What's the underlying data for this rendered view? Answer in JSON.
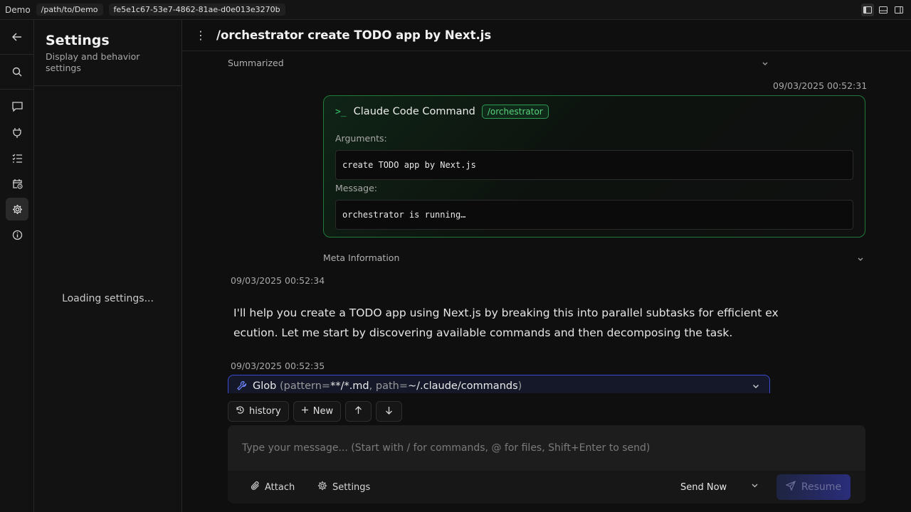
{
  "topbar": {
    "app_name": "Demo",
    "path": "/path/to/Demo",
    "session_id": "fe5e1c67-53e7-4862-81ae-d0e013e3270b",
    "layout_icons": [
      "sidebar-layout-icon",
      "bottom-panel-layout-icon",
      "right-panel-layout-icon"
    ]
  },
  "rail": {
    "items": [
      "back-arrow-icon",
      "search-icon",
      "chat-icon",
      "plug-icon",
      "tasks-icon",
      "calendar-clock-icon",
      "gear-icon",
      "info-icon"
    ],
    "active": "gear-icon"
  },
  "settings": {
    "title": "Settings",
    "subtitle": "Display and behavior settings",
    "loading": "Loading settings..."
  },
  "header": {
    "title": "/orchestrator create TODO app by Next.js"
  },
  "conversation": {
    "summarized_label": "Summarized",
    "command_timestamp": "09/03/2025 00:52:31",
    "command_card": {
      "title": "Claude Code Command",
      "badge": "/orchestrator",
      "arguments_label": "Arguments:",
      "arguments_value": "create TODO app by Next.js",
      "message_label": "Message:",
      "message_value": "orchestrator is running…"
    },
    "meta_info_label": "Meta Information",
    "assistant_timestamp": "09/03/2025 00:52:34",
    "assistant_text": "I'll help you create a TODO app using Next.js by breaking this into parallel subtasks for efficient execution. Let me start by discovering available commands and then decomposing the task.",
    "tool_timestamp": "09/03/2025 00:52:35",
    "tool": {
      "name": "Glob",
      "open": " (",
      "p1_key": "pattern=",
      "p1_val": "**/*.md",
      "sep": ", ",
      "p2_key": "path=",
      "p2_val": "~/.claude/commands",
      "close": ")"
    }
  },
  "toolbar": {
    "history_label": "history",
    "new_label": "New"
  },
  "composer": {
    "placeholder": "Type your message... (Start with / for commands, @ for files, Shift+Enter to send)",
    "attach_label": "Attach",
    "settings_label": "Settings",
    "send_mode": "Send Now",
    "resume_label": "Resume"
  },
  "colors": {
    "accent_green": "#2f9a52",
    "accent_blue": "#3a4bd1",
    "background": "#0f0f0f"
  }
}
